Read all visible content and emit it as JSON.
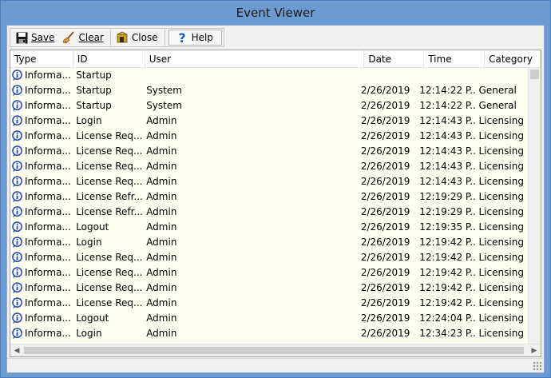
{
  "window": {
    "title": "Event Viewer"
  },
  "toolbar": {
    "save_label": "Save",
    "clear_label": "Clear",
    "close_label": "Close",
    "help_label": "Help"
  },
  "icons": {
    "save": "save-icon",
    "clear": "broom-icon",
    "close": "door-icon",
    "help": "question-icon",
    "row_type": "info-icon"
  },
  "colors": {
    "title_bar": "#6c9bd2",
    "grid_background": "#fffff0",
    "info_icon": "#2846b8"
  },
  "grid": {
    "columns": [
      "Type",
      "ID",
      "User",
      "Date",
      "Time",
      "Category"
    ],
    "rows": [
      {
        "type": "Informa...",
        "id": "Startup",
        "user": "",
        "date": "",
        "time": "",
        "category": ""
      },
      {
        "type": "Informa...",
        "id": "Startup",
        "user": "System",
        "date": "2/26/2019",
        "time": "12:14:22 P...",
        "category": "General"
      },
      {
        "type": "Informa...",
        "id": "Startup",
        "user": "System",
        "date": "2/26/2019",
        "time": "12:14:22 P...",
        "category": "General"
      },
      {
        "type": "Informa...",
        "id": "Login",
        "user": "Admin",
        "date": "2/26/2019",
        "time": "12:14:43 P...",
        "category": "Licensing"
      },
      {
        "type": "Informa...",
        "id": "License Req...",
        "user": "Admin",
        "date": "2/26/2019",
        "time": "12:14:43 P...",
        "category": "Licensing"
      },
      {
        "type": "Informa...",
        "id": "License Req...",
        "user": "Admin",
        "date": "2/26/2019",
        "time": "12:14:43 P...",
        "category": "Licensing"
      },
      {
        "type": "Informa...",
        "id": "License Req...",
        "user": "Admin",
        "date": "2/26/2019",
        "time": "12:14:43 P...",
        "category": "Licensing"
      },
      {
        "type": "Informa...",
        "id": "License Req...",
        "user": "Admin",
        "date": "2/26/2019",
        "time": "12:14:43 P...",
        "category": "Licensing"
      },
      {
        "type": "Informa...",
        "id": "License Refr...",
        "user": "Admin",
        "date": "2/26/2019",
        "time": "12:19:29 P...",
        "category": "Licensing"
      },
      {
        "type": "Informa...",
        "id": "License Refr...",
        "user": "Admin",
        "date": "2/26/2019",
        "time": "12:19:29 P...",
        "category": "Licensing"
      },
      {
        "type": "Informa...",
        "id": "Logout",
        "user": "Admin",
        "date": "2/26/2019",
        "time": "12:19:35 P...",
        "category": "Licensing"
      },
      {
        "type": "Informa...",
        "id": "Login",
        "user": "Admin",
        "date": "2/26/2019",
        "time": "12:19:42 P...",
        "category": "Licensing"
      },
      {
        "type": "Informa...",
        "id": "License Req...",
        "user": "Admin",
        "date": "2/26/2019",
        "time": "12:19:42 P...",
        "category": "Licensing"
      },
      {
        "type": "Informa...",
        "id": "License Req...",
        "user": "Admin",
        "date": "2/26/2019",
        "time": "12:19:42 P...",
        "category": "Licensing"
      },
      {
        "type": "Informa...",
        "id": "License Req...",
        "user": "Admin",
        "date": "2/26/2019",
        "time": "12:19:42 P...",
        "category": "Licensing"
      },
      {
        "type": "Informa...",
        "id": "License Req...",
        "user": "Admin",
        "date": "2/26/2019",
        "time": "12:19:42 P...",
        "category": "Licensing"
      },
      {
        "type": "Informa...",
        "id": "Logout",
        "user": "Admin",
        "date": "2/26/2019",
        "time": "12:24:04 P...",
        "category": "Licensing"
      },
      {
        "type": "Informa...",
        "id": "Login",
        "user": "Admin",
        "date": "2/26/2019",
        "time": "12:34:23 P...",
        "category": "Licensing"
      }
    ]
  }
}
